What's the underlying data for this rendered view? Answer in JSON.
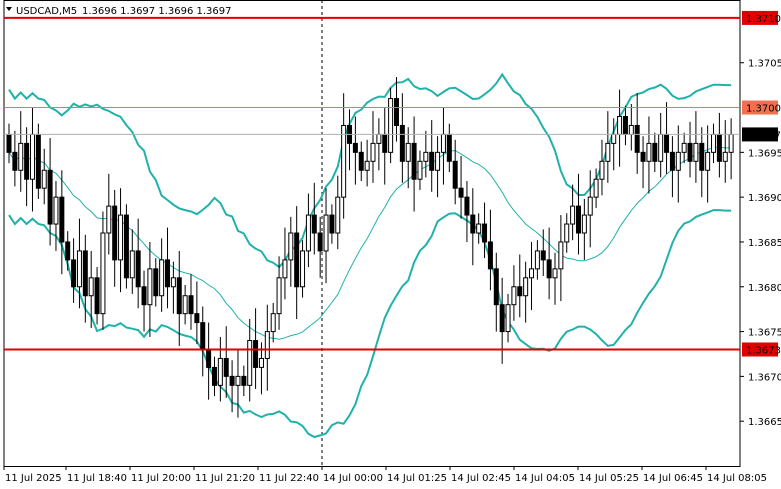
{
  "header": {
    "symbol": "USDCAD,M5",
    "ohlc": "1.3696 1.3697 1.3696 1.3697"
  },
  "chart_data": {
    "type": "candlestick",
    "symbol": "USDCAD",
    "timeframe": "M5",
    "ylim": [
      1.366,
      1.3712
    ],
    "y_ticks": [
      "1.3705",
      "1.3695",
      "1.3690",
      "1.3685",
      "1.3680",
      "1.3675",
      "1.3670",
      "1.3665"
    ],
    "x_ticks": [
      "11 Jul 2025",
      "11 Jul 18:40",
      "11 Jul 20:00",
      "11 Jul 21:20",
      "11 Jul 22:40",
      "14 Jul 00:00",
      "14 Jul 01:25",
      "14 Jul 02:45",
      "14 Jul 04:05",
      "14 Jul 05:25",
      "14 Jul 06:45",
      "14 Jul 08:05"
    ],
    "levels": [
      {
        "label": "1.3710",
        "value": 1.371,
        "color": "#e00000"
      },
      {
        "label": "1.3700",
        "value": 1.37,
        "color": "#f07050"
      },
      {
        "label": "1.3673",
        "value": 1.3673,
        "color": "#e00000"
      }
    ],
    "current_price": {
      "label": "1.3697",
      "value": 1.3697
    },
    "separator_label": "14 Jul 00:00",
    "closes": [
      1.3695,
      1.3693,
      1.3696,
      1.3692,
      1.3697,
      1.3691,
      1.3693,
      1.3687,
      1.369,
      1.3685,
      1.3683,
      1.368,
      1.3684,
      1.3679,
      1.3681,
      1.3677,
      1.3686,
      1.3689,
      1.3683,
      1.3688,
      1.3681,
      1.3684,
      1.368,
      1.3678,
      1.3682,
      1.3679,
      1.3683,
      1.368,
      1.3681,
      1.3677,
      1.3679,
      1.3677,
      1.3676,
      1.3673,
      1.3671,
      1.3669,
      1.3672,
      1.367,
      1.3669,
      1.367,
      1.3669,
      1.3674,
      1.3671,
      1.3672,
      1.3675,
      1.3677,
      1.3681,
      1.3683,
      1.3686,
      1.368,
      1.3684,
      1.3688,
      1.3686,
      1.3684,
      1.3688,
      1.3686,
      1.369,
      1.3698,
      1.3696,
      1.3695,
      1.3693,
      1.3694,
      1.3696,
      1.3697,
      1.3695,
      1.3701,
      1.3698,
      1.3694,
      1.3696,
      1.3692,
      1.3694,
      1.3695,
      1.3693,
      1.3695,
      1.3697,
      1.3694,
      1.3691,
      1.369,
      1.3688,
      1.3686,
      1.3687,
      1.3685,
      1.3682,
      1.3678,
      1.3675,
      1.3678,
      1.368,
      1.3679,
      1.3681,
      1.3682,
      1.3684,
      1.3683,
      1.3681,
      1.3682,
      1.3685,
      1.3687,
      1.3689,
      1.3686,
      1.3688,
      1.369,
      1.3692,
      1.3694,
      1.3696,
      1.3697,
      1.3699,
      1.3697,
      1.3698,
      1.3695,
      1.3694,
      1.3696,
      1.3694,
      1.3697,
      1.3695,
      1.3693,
      1.3695,
      1.3696,
      1.3694,
      1.3696,
      1.3693,
      1.3695,
      1.3697,
      1.3694,
      1.3695,
      1.3697
    ]
  }
}
